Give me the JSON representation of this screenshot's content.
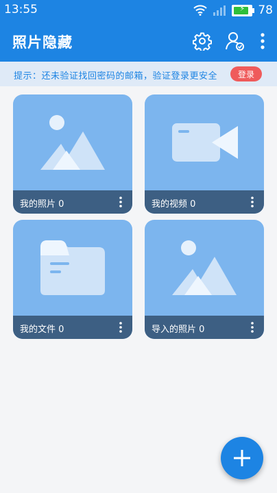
{
  "status_bar": {
    "time": "13:55",
    "battery_level": "78",
    "battery_charging_symbol": "⚡"
  },
  "app_bar": {
    "title": "照片隐藏",
    "icons": [
      "settings-gear-icon",
      "user-account-icon",
      "more-vertical-icon"
    ]
  },
  "hint_bar": {
    "text": "提示：还未验证找回密码的邮箱，验证登录更安全",
    "login_label": "登录"
  },
  "cards": [
    {
      "label": "我的照片 0",
      "icon": "photo-icon"
    },
    {
      "label": "我的视频 0",
      "icon": "video-icon"
    },
    {
      "label": "我的文件 0",
      "icon": "folder-icon"
    },
    {
      "label": "导入的照片 0",
      "icon": "photo-icon"
    }
  ],
  "fab": {
    "icon": "plus-icon"
  },
  "colors": {
    "primary": "#1d84e3",
    "hint_background": "#dfeaf7",
    "login_button": "#ef5b5b",
    "card_background": "#7cb5ee",
    "card_footer": "#3d5f83"
  }
}
